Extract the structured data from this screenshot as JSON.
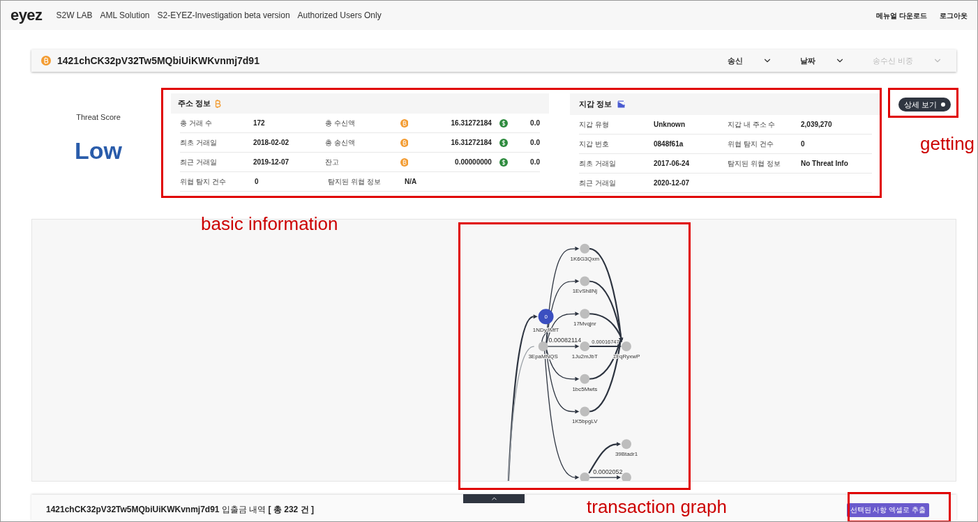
{
  "header": {
    "logo": "eyez",
    "nav": [
      "S2W LAB",
      "AML Solution",
      "S2-EYEZ-Investigation beta version",
      "Authorized Users Only"
    ],
    "actions": [
      "메뉴얼 다운로드",
      "로그아웃"
    ]
  },
  "address_bar": {
    "address": "1421chCK32pV32Tw5MQbiUiKWKvnmj7d91",
    "filters": [
      {
        "label": "송신",
        "disabled": false
      },
      {
        "label": "날짜",
        "disabled": false
      },
      {
        "label": "송수신 비중",
        "disabled": true
      }
    ]
  },
  "threat": {
    "title": "Threat Score",
    "level": "Low"
  },
  "address_info": {
    "title": "주소 정보",
    "rows": [
      {
        "label": "총 거래 수",
        "value": "172",
        "label2": "총 수신액",
        "btc": "16.31272184",
        "usd": "0.0"
      },
      {
        "label": "최초 거래일",
        "value": "2018-02-02",
        "label2": "총 송신액",
        "btc": "16.31272184",
        "usd": "0.0"
      },
      {
        "label": "최근 거래일",
        "value": "2019-12-07",
        "label2": "잔고",
        "btc": "0.00000000",
        "usd": "0.0"
      },
      {
        "label": "위협 탐지 건수",
        "value": "0",
        "label2": "탐지된 위협 정보",
        "value2": "N/A"
      }
    ]
  },
  "wallet_info": {
    "title": "지갑 정보",
    "rows": [
      {
        "label": "지갑 유형",
        "value": "Unknown",
        "label2": "지갑 내 주소 수",
        "value2": "2,039,270"
      },
      {
        "label": "지갑 번호",
        "value": "0848f61a",
        "label2": "위협 탐지 건수",
        "value2": "0"
      },
      {
        "label": "최초 거래일",
        "value": "2017-06-24",
        "label2": "탐지된 위협 정보",
        "value2": "No Threat Info"
      },
      {
        "label": "최근 거래일",
        "value": "2020-12-07"
      }
    ]
  },
  "detail_button": "상세 보기",
  "graph": {
    "nodes": [
      {
        "label": "1NDyJMfT",
        "badge": "0",
        "selected": true
      },
      {
        "label": "3EpaMNQS",
        "selected": false
      },
      {
        "label": "1K6G3Qxm",
        "selected": false
      },
      {
        "label": "1EvSh8Nj",
        "selected": false
      },
      {
        "label": "17Mvqjnr",
        "selected": false
      },
      {
        "label": "1Ju2mJbT",
        "selected": false
      },
      {
        "label": "1bc5Mwts",
        "selected": false
      },
      {
        "label": "1K5bpgLV",
        "selected": false
      },
      {
        "label": "1FqRyxwP",
        "selected": false
      },
      {
        "label": "39Btadr1",
        "selected": false
      },
      {
        "selected": false
      },
      {
        "selected": false
      }
    ],
    "edge_labels": [
      "0.00082114",
      "0.00016747",
      "0.0002052"
    ]
  },
  "history": {
    "title": "**1421chCK32pV32Tw5MQbiUiKWKvnmj7d91** 입출금 내역 **[ 총 232 건 ]**",
    "export_button": "선택된 사항 엑셀로 추출"
  },
  "annotations": [
    {
      "text": "basic information"
    },
    {
      "text": "getting"
    },
    {
      "text": "transaction graph"
    }
  ]
}
